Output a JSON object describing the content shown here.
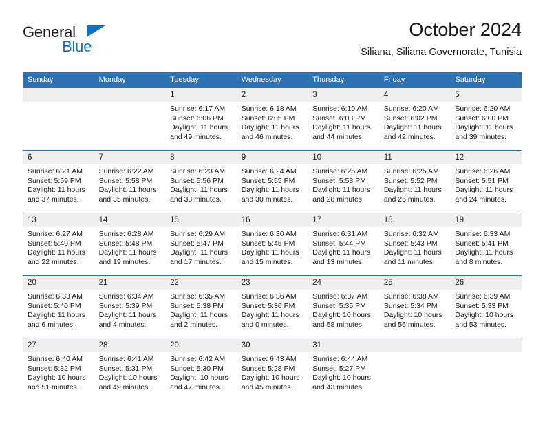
{
  "brand": {
    "name_part1": "General",
    "name_part2": "Blue",
    "accent_color": "#1173c4"
  },
  "header": {
    "title": "October 2024",
    "subtitle": "Siliana, Siliana Governorate, Tunisia"
  },
  "theme": {
    "header_bg": "#2f72b4",
    "daynum_bg": "#efefef",
    "grid_line": "#2f72b4"
  },
  "weekday_headers": [
    "Sunday",
    "Monday",
    "Tuesday",
    "Wednesday",
    "Thursday",
    "Friday",
    "Saturday"
  ],
  "weeks": [
    [
      {
        "day": "",
        "lines": []
      },
      {
        "day": "",
        "lines": []
      },
      {
        "day": "1",
        "lines": [
          "Sunrise: 6:17 AM",
          "Sunset: 6:06 PM",
          "Daylight: 11 hours",
          "and 49 minutes."
        ]
      },
      {
        "day": "2",
        "lines": [
          "Sunrise: 6:18 AM",
          "Sunset: 6:05 PM",
          "Daylight: 11 hours",
          "and 46 minutes."
        ]
      },
      {
        "day": "3",
        "lines": [
          "Sunrise: 6:19 AM",
          "Sunset: 6:03 PM",
          "Daylight: 11 hours",
          "and 44 minutes."
        ]
      },
      {
        "day": "4",
        "lines": [
          "Sunrise: 6:20 AM",
          "Sunset: 6:02 PM",
          "Daylight: 11 hours",
          "and 42 minutes."
        ]
      },
      {
        "day": "5",
        "lines": [
          "Sunrise: 6:20 AM",
          "Sunset: 6:00 PM",
          "Daylight: 11 hours",
          "and 39 minutes."
        ]
      }
    ],
    [
      {
        "day": "6",
        "lines": [
          "Sunrise: 6:21 AM",
          "Sunset: 5:59 PM",
          "Daylight: 11 hours",
          "and 37 minutes."
        ]
      },
      {
        "day": "7",
        "lines": [
          "Sunrise: 6:22 AM",
          "Sunset: 5:58 PM",
          "Daylight: 11 hours",
          "and 35 minutes."
        ]
      },
      {
        "day": "8",
        "lines": [
          "Sunrise: 6:23 AM",
          "Sunset: 5:56 PM",
          "Daylight: 11 hours",
          "and 33 minutes."
        ]
      },
      {
        "day": "9",
        "lines": [
          "Sunrise: 6:24 AM",
          "Sunset: 5:55 PM",
          "Daylight: 11 hours",
          "and 30 minutes."
        ]
      },
      {
        "day": "10",
        "lines": [
          "Sunrise: 6:25 AM",
          "Sunset: 5:53 PM",
          "Daylight: 11 hours",
          "and 28 minutes."
        ]
      },
      {
        "day": "11",
        "lines": [
          "Sunrise: 6:25 AM",
          "Sunset: 5:52 PM",
          "Daylight: 11 hours",
          "and 26 minutes."
        ]
      },
      {
        "day": "12",
        "lines": [
          "Sunrise: 6:26 AM",
          "Sunset: 5:51 PM",
          "Daylight: 11 hours",
          "and 24 minutes."
        ]
      }
    ],
    [
      {
        "day": "13",
        "lines": [
          "Sunrise: 6:27 AM",
          "Sunset: 5:49 PM",
          "Daylight: 11 hours",
          "and 22 minutes."
        ]
      },
      {
        "day": "14",
        "lines": [
          "Sunrise: 6:28 AM",
          "Sunset: 5:48 PM",
          "Daylight: 11 hours",
          "and 19 minutes."
        ]
      },
      {
        "day": "15",
        "lines": [
          "Sunrise: 6:29 AM",
          "Sunset: 5:47 PM",
          "Daylight: 11 hours",
          "and 17 minutes."
        ]
      },
      {
        "day": "16",
        "lines": [
          "Sunrise: 6:30 AM",
          "Sunset: 5:45 PM",
          "Daylight: 11 hours",
          "and 15 minutes."
        ]
      },
      {
        "day": "17",
        "lines": [
          "Sunrise: 6:31 AM",
          "Sunset: 5:44 PM",
          "Daylight: 11 hours",
          "and 13 minutes."
        ]
      },
      {
        "day": "18",
        "lines": [
          "Sunrise: 6:32 AM",
          "Sunset: 5:43 PM",
          "Daylight: 11 hours",
          "and 11 minutes."
        ]
      },
      {
        "day": "19",
        "lines": [
          "Sunrise: 6:33 AM",
          "Sunset: 5:41 PM",
          "Daylight: 11 hours",
          "and 8 minutes."
        ]
      }
    ],
    [
      {
        "day": "20",
        "lines": [
          "Sunrise: 6:33 AM",
          "Sunset: 5:40 PM",
          "Daylight: 11 hours",
          "and 6 minutes."
        ]
      },
      {
        "day": "21",
        "lines": [
          "Sunrise: 6:34 AM",
          "Sunset: 5:39 PM",
          "Daylight: 11 hours",
          "and 4 minutes."
        ]
      },
      {
        "day": "22",
        "lines": [
          "Sunrise: 6:35 AM",
          "Sunset: 5:38 PM",
          "Daylight: 11 hours",
          "and 2 minutes."
        ]
      },
      {
        "day": "23",
        "lines": [
          "Sunrise: 6:36 AM",
          "Sunset: 5:36 PM",
          "Daylight: 11 hours",
          "and 0 minutes."
        ]
      },
      {
        "day": "24",
        "lines": [
          "Sunrise: 6:37 AM",
          "Sunset: 5:35 PM",
          "Daylight: 10 hours",
          "and 58 minutes."
        ]
      },
      {
        "day": "25",
        "lines": [
          "Sunrise: 6:38 AM",
          "Sunset: 5:34 PM",
          "Daylight: 10 hours",
          "and 56 minutes."
        ]
      },
      {
        "day": "26",
        "lines": [
          "Sunrise: 6:39 AM",
          "Sunset: 5:33 PM",
          "Daylight: 10 hours",
          "and 53 minutes."
        ]
      }
    ],
    [
      {
        "day": "27",
        "lines": [
          "Sunrise: 6:40 AM",
          "Sunset: 5:32 PM",
          "Daylight: 10 hours",
          "and 51 minutes."
        ]
      },
      {
        "day": "28",
        "lines": [
          "Sunrise: 6:41 AM",
          "Sunset: 5:31 PM",
          "Daylight: 10 hours",
          "and 49 minutes."
        ]
      },
      {
        "day": "29",
        "lines": [
          "Sunrise: 6:42 AM",
          "Sunset: 5:30 PM",
          "Daylight: 10 hours",
          "and 47 minutes."
        ]
      },
      {
        "day": "30",
        "lines": [
          "Sunrise: 6:43 AM",
          "Sunset: 5:28 PM",
          "Daylight: 10 hours",
          "and 45 minutes."
        ]
      },
      {
        "day": "31",
        "lines": [
          "Sunrise: 6:44 AM",
          "Sunset: 5:27 PM",
          "Daylight: 10 hours",
          "and 43 minutes."
        ]
      },
      {
        "day": "",
        "lines": []
      },
      {
        "day": "",
        "lines": []
      }
    ]
  ]
}
